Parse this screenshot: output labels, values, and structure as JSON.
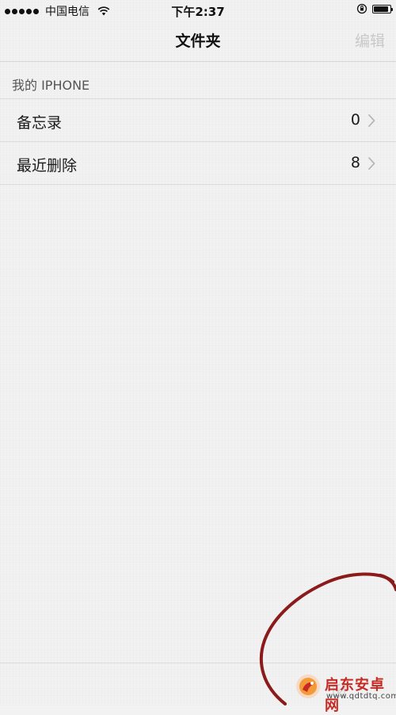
{
  "status_bar": {
    "carrier": "中国电信",
    "time": "下午2:37",
    "signal_bars": 5,
    "battery_level": 0.9
  },
  "nav": {
    "title": "文件夹",
    "edit_label": "编辑"
  },
  "section": {
    "header": "我的 IPHONE"
  },
  "folders": [
    {
      "name": "备忘录",
      "count": "0"
    },
    {
      "name": "最近删除",
      "count": "8"
    }
  ],
  "watermark": {
    "name": "启东安卓网",
    "url": "www.qdtdtq.com"
  },
  "colors": {
    "background": "#f3f2f2",
    "separator": "#dcdbdb",
    "disabled_text": "#c9c8c8",
    "annotation": "#8b1a1a",
    "watermark_red": "#c62a23"
  },
  "icons": {
    "wifi": "wifi-icon",
    "rotation_lock": "rotation-lock-icon",
    "battery": "battery-icon",
    "chevron": "chevron-right-icon",
    "compose": "compose-icon"
  }
}
